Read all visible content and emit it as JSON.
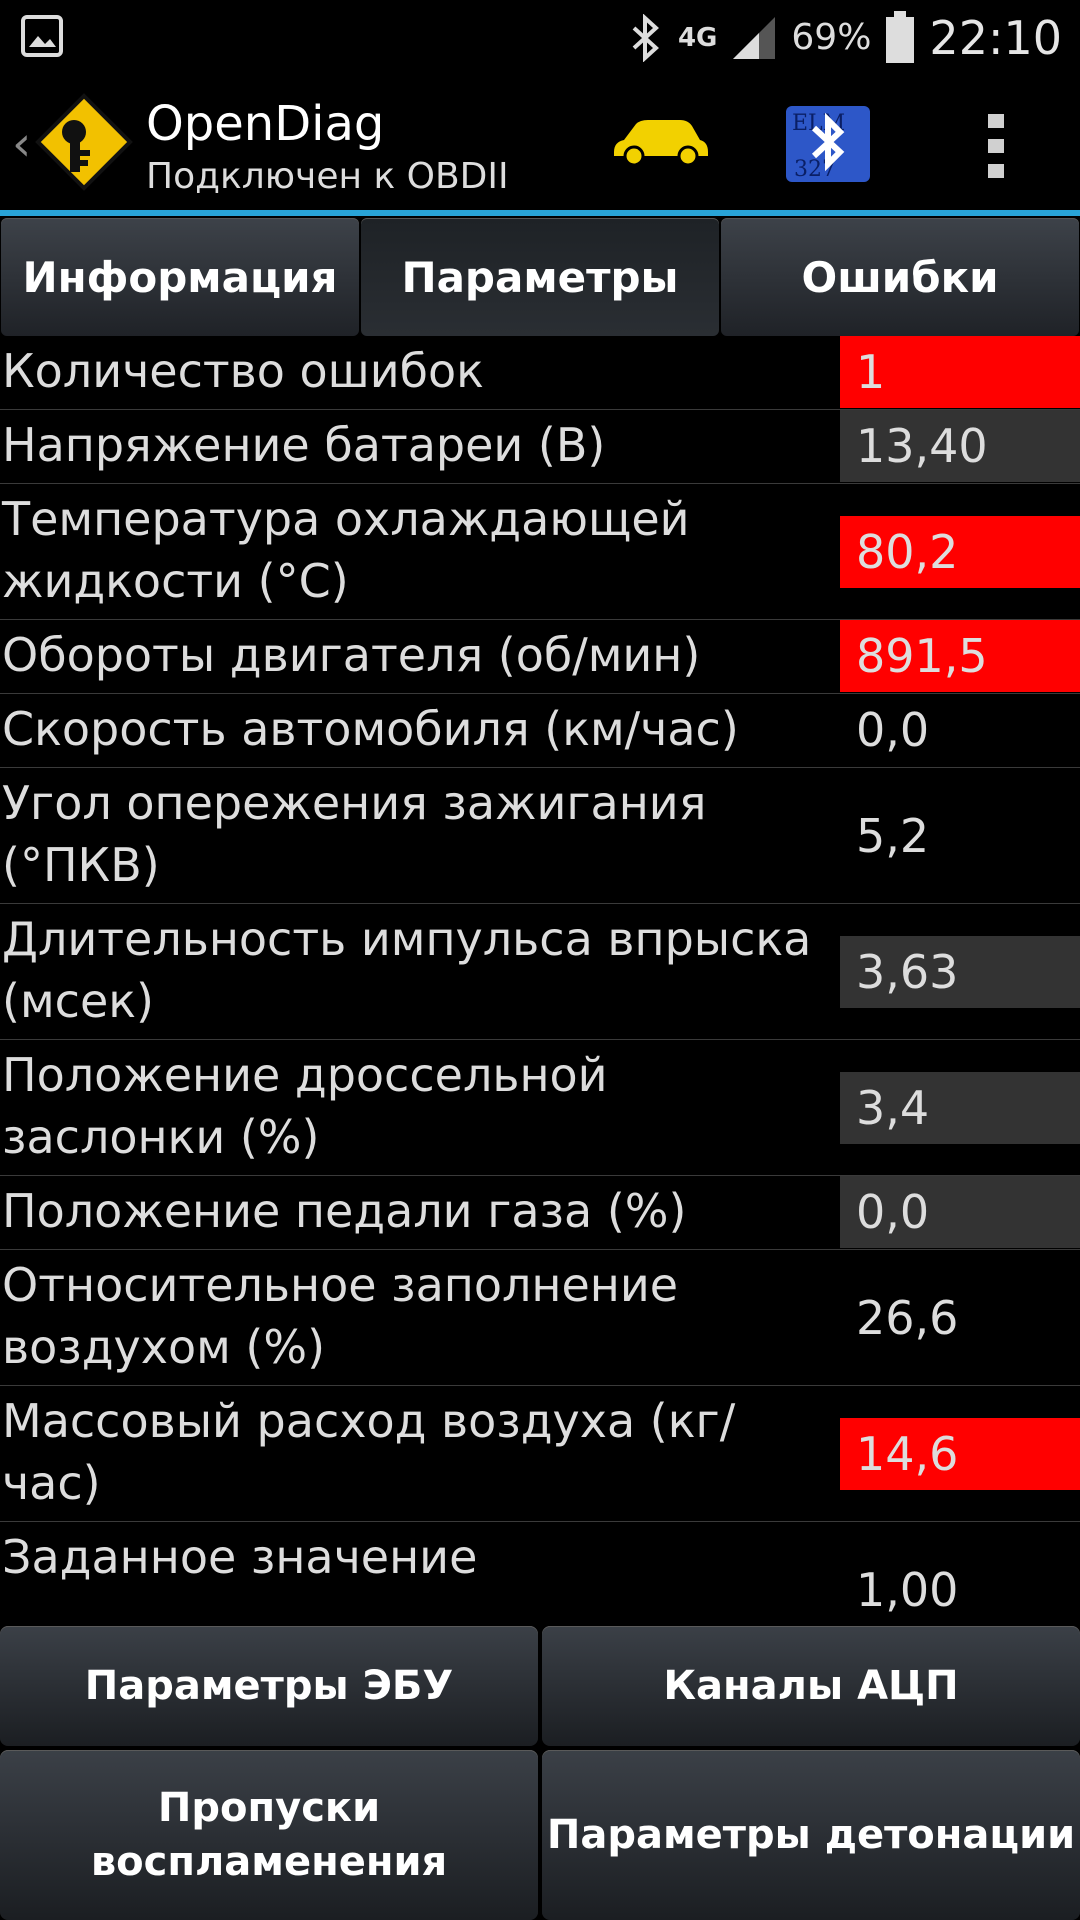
{
  "statusbar": {
    "network": "4G",
    "battery": "69%",
    "time": "22:10"
  },
  "app": {
    "title": "OpenDiag",
    "subtitle": "Подключен к OBDII",
    "icons": {
      "logo": "key-in-diamond-icon",
      "car": "car-icon",
      "bluetooth": "bluetooth-elm327-icon",
      "overflow": "overflow-menu-icon"
    },
    "accent_color": "#29a3d6"
  },
  "tabs": [
    {
      "label": "Информация",
      "active": false
    },
    {
      "label": "Параметры",
      "active": true
    },
    {
      "label": "Ошибки",
      "active": false
    }
  ],
  "colors": {
    "alert_value_bg": "#ff0000",
    "neutral_value_bg": "#333333"
  },
  "parameters": [
    {
      "label": "Количество ошибок",
      "value": "1",
      "style": "alert"
    },
    {
      "label": "Напряжение батареи (В)",
      "value": "13,40",
      "style": "neutral"
    },
    {
      "label": "Температура охлаждающей жидкости (°С)",
      "value": "80,2",
      "style": "alert"
    },
    {
      "label": "Обороты двигателя (об/мин)",
      "value": "891,5",
      "style": "alert"
    },
    {
      "label": "Скорость автомобиля (км/час)",
      "value": "0,0",
      "style": "none"
    },
    {
      "label": "Угол опережения зажигания (°ПКВ)",
      "value": "5,2",
      "style": "none"
    },
    {
      "label": "Длительность импульса впрыска (мсек)",
      "value": "3,63",
      "style": "neutral"
    },
    {
      "label": "Положение дроссельной заслонки (%)",
      "value": "3,4",
      "style": "neutral"
    },
    {
      "label": "Положение педали газа (%)",
      "value": "0,0",
      "style": "neutral"
    },
    {
      "label": "Относительное заполнение воздухом (%)",
      "value": "26,6",
      "style": "none"
    },
    {
      "label": "Массовый расход воздуха (кг/ час)",
      "value": "14,6",
      "style": "alert"
    },
    {
      "label": "Заданное значение",
      "value": "1,00",
      "style": "none"
    }
  ],
  "bottom_buttons": [
    "Параметры ЭБУ",
    "Каналы АЦП",
    "Пропуски воспламенения",
    "Параметры детонации"
  ]
}
